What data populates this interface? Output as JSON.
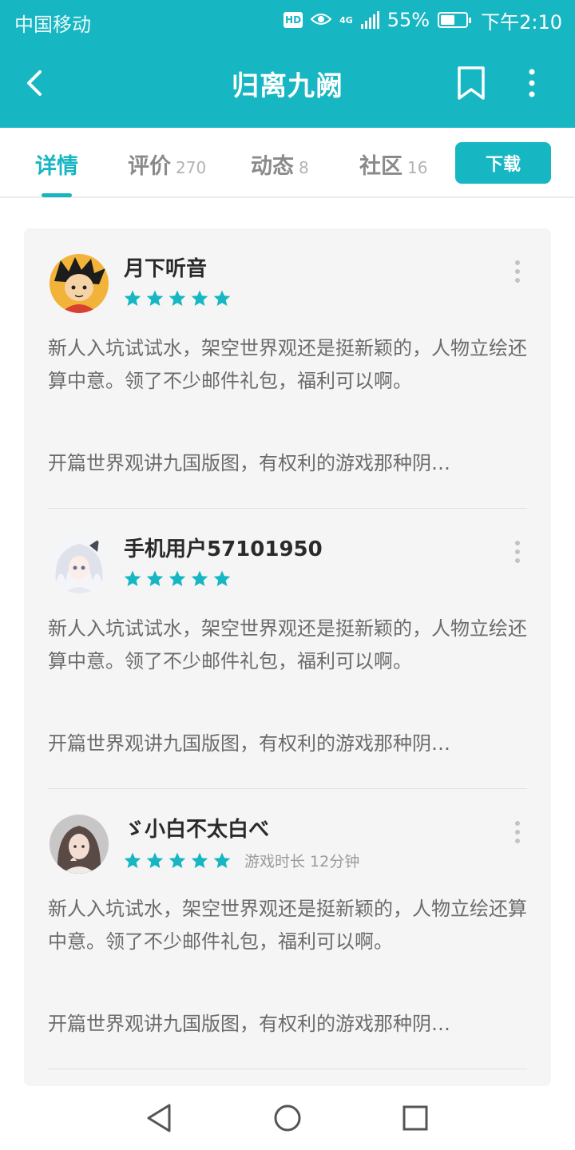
{
  "status_bar": {
    "carrier": "中国移动",
    "hd": "HD",
    "network": "4G",
    "battery": "55%",
    "battery_level": 0.55,
    "time": "下午2:10"
  },
  "header": {
    "title": "归离九阙"
  },
  "tabs": [
    {
      "label": "详情",
      "count": "",
      "active": true
    },
    {
      "label": "评价",
      "count": "270",
      "active": false
    },
    {
      "label": "动态",
      "count": "8",
      "active": false
    },
    {
      "label": "社区",
      "count": "16",
      "active": false
    }
  ],
  "download_label": "下载",
  "reviews": [
    {
      "username": "月下听音",
      "stars": 5,
      "playtime": "",
      "text": "新人入坑试试水，架空世界观还是挺新颖的，人物立绘还算中意。领了不少邮件礼包，福利可以啊。",
      "more": "开篇世界观讲九国版图，有权利的游戏那种阴…"
    },
    {
      "username": "手机用户57101950",
      "stars": 5,
      "playtime": "",
      "text": "新人入坑试试水，架空世界观还是挺新颖的，人物立绘还算中意。领了不少邮件礼包，福利可以啊。",
      "more": "开篇世界观讲九国版图，有权利的游戏那种阴…"
    },
    {
      "username": "ゞ小白不太白べ",
      "stars": 5,
      "playtime": "游戏时长 12分钟",
      "text": "新人入坑试水，架空世界观还是挺新颖的，人物立绘还算中意。领了不少邮件礼包，福利可以啊。",
      "more": "开篇世界观讲九国版图，有权利的游戏那种阴…"
    }
  ],
  "colors": {
    "accent": "#17b6c3",
    "card_bg": "#f5f5f5",
    "text_gray": "#6b6b6b"
  },
  "icons": {
    "back": "back-arrow-icon",
    "bookmark": "bookmark-icon",
    "more": "more-vertical-icon",
    "star": "star-icon",
    "nav_back": "nav-back-triangle-icon",
    "nav_home": "nav-home-circle-icon",
    "nav_recent": "nav-recent-square-icon"
  }
}
